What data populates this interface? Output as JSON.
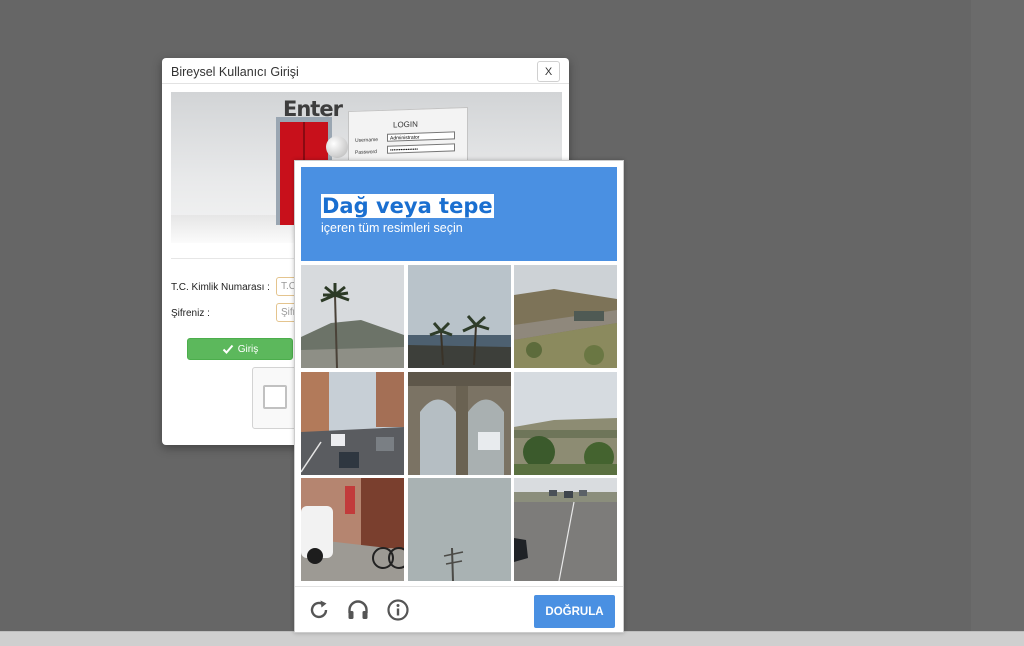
{
  "login_modal": {
    "title": "Bireysel Kullanıcı Girişi",
    "close_label": "X",
    "banner": {
      "enter_text": "Enter",
      "login_title": "LOGIN",
      "username_label": "Username",
      "username_value": "Administrator",
      "password_label": "Password",
      "password_value": "••••••••••••••••"
    },
    "tc_label": "T.C. Kimlik Numarası :",
    "tc_placeholder": "T.C.",
    "password_label": "Şifreniz :",
    "password_placeholder": "Şifr",
    "submit_label": "Giriş"
  },
  "captcha": {
    "title": "Dağ veya tepe",
    "subtitle": "içeren tüm resimleri seçin",
    "tiles": [
      "palm-tree-hill",
      "palms-seaside",
      "hillside-road",
      "city-street-cars",
      "stone-arches",
      "hills-bridge",
      "sidewalk-bicycles",
      "pole-sky",
      "highway-cars"
    ],
    "verify_label": "DOĞRULA",
    "icons": [
      "reload-icon",
      "audio-icon",
      "info-icon"
    ],
    "accent_color": "#4a90e2"
  }
}
